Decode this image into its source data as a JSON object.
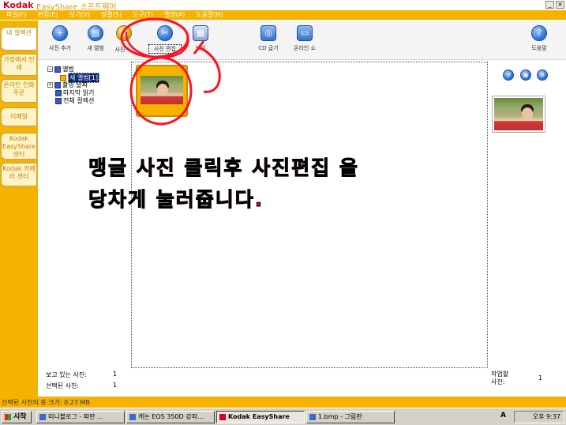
{
  "titlebar": {
    "brand": "Kodak",
    "app_name": "EasyShare  소프트웨어",
    "minimize": "_",
    "close": "×"
  },
  "menubar": [
    "파일(F)",
    "편집(E)",
    "보기(V)",
    "정렬(S)",
    "도구(T)",
    "앨범(A)",
    "도움말(H)"
  ],
  "left_nav": [
    "내 컬렉션",
    "가정에서 인쇄",
    "온라인 인화 주문",
    "이메일",
    "Kodak EasyShare 센터",
    "Kodak 카메라 센터"
  ],
  "toolbar": {
    "add_photos": "사진 추가",
    "new_album": "새 앨범",
    "print_partial": "사진",
    "edit_photo": "사진 편집",
    "view_partial": "보기",
    "cd_burn": "CD 굽기",
    "online_show": "온라인 쇼",
    "help": "도움말"
  },
  "tree": {
    "album_root": "앨범",
    "new_album": "새 앨범[1]",
    "date_taken": "촬영 날짜",
    "last_import": "마지막 읽기",
    "all_collection": "전체 컬렉션"
  },
  "stats": {
    "viewing_label": "보고 있는 사진:",
    "viewing_count": "1",
    "selected_label": "선택된 사진:",
    "selected_count": "1",
    "work_label_1": "작업할",
    "work_label_2": "사진:",
    "work_count": "1"
  },
  "statusbar": {
    "text": "선택된 사진의 총 크기: 0.27 MB"
  },
  "taskbar": {
    "start": "시작",
    "tasks": [
      "미니블로그 - 파란 ...",
      "캐논 EOS 350D 강좌...",
      "Kodak EasyShare",
      "1.bmp - 그림판"
    ],
    "ime": "A",
    "clock": "오후 9:37"
  },
  "annotation": {
    "line1": "맹글 사진 클릭후 사진편집 을",
    "line2": "당차게  눌러줍니다."
  },
  "colors": {
    "brand_orange": "#f6b200",
    "kodak_red": "#d6001c",
    "annotation_red": "#e8001c"
  }
}
